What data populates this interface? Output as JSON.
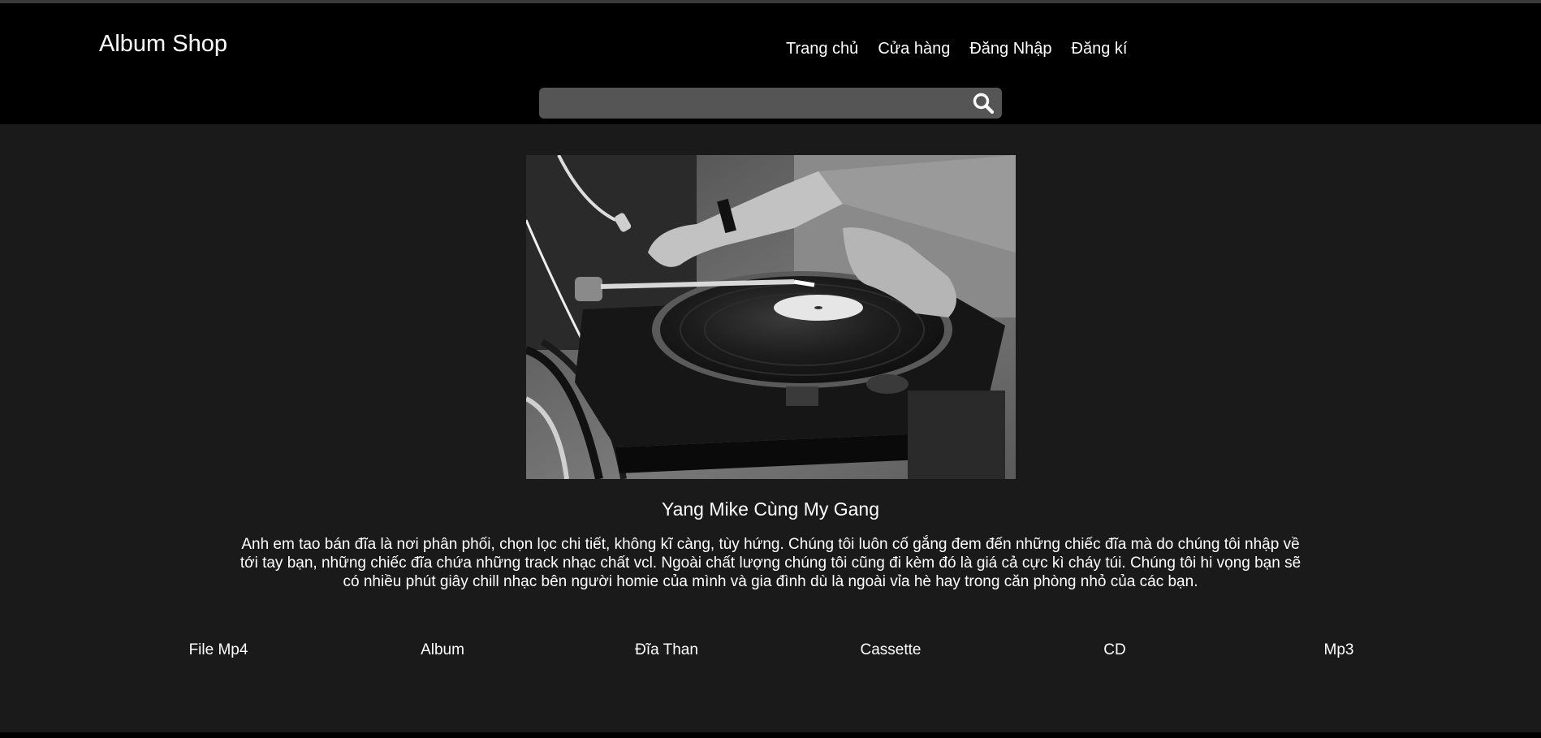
{
  "header": {
    "logo": "Album Shop",
    "nav": [
      {
        "label": "Trang chủ"
      },
      {
        "label": "Cửa hàng"
      },
      {
        "label": "Đăng Nhập"
      },
      {
        "label": "Đăng kí"
      }
    ],
    "search": {
      "value": "",
      "placeholder": "",
      "icon": "search-icon"
    }
  },
  "hero": {
    "image": "turntable-photo"
  },
  "about": {
    "title": "Yang Mike Cùng My Gang",
    "description": "Anh em tao bán đĩa là nơi phân phối, chọn lọc chi tiết, không kĩ càng, tùy hứng. Chúng tôi luôn cố gắng đem đến những chiếc đĩa mà do chúng tôi nhập về tới tay bạn, những chiếc đĩa chứa những track nhạc chất vcl. Ngoài chất lượng chúng tôi cũng đi kèm đó là giá cả cực kì cháy túi. Chúng tôi hi vọng bạn sẽ có nhiều phút giây chill nhạc bên người homie của mình và gia đình dù là ngoài vỉa hè hay trong căn phòng nhỏ của các bạn."
  },
  "categories": [
    {
      "label": "File Mp4"
    },
    {
      "label": "Album"
    },
    {
      "label": "Đĩa Than"
    },
    {
      "label": "Cassette"
    },
    {
      "label": "CD"
    },
    {
      "label": "Mp3"
    }
  ],
  "colors": {
    "header_bg": "#000000",
    "page_bg": "#1a1a1a",
    "search_bg": "#555555",
    "text": "#ffffff"
  }
}
